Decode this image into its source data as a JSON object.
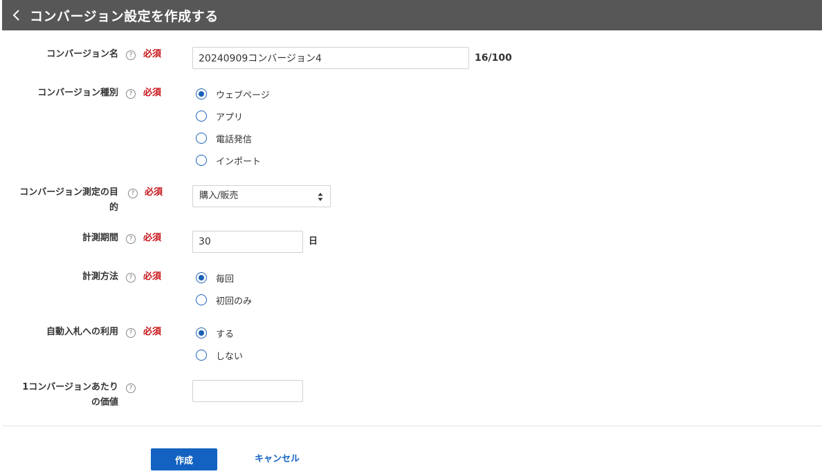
{
  "header": {
    "title": "コンバージョン設定を作成する"
  },
  "required_label": "必須",
  "help_glyph": "?",
  "fields": {
    "name": {
      "label": "コンバージョン名",
      "value": "20240909コンバージョン4",
      "counter": "16/100"
    },
    "type": {
      "label": "コンバージョン種別",
      "options": [
        "ウェブページ",
        "アプリ",
        "電話発信",
        "インポート"
      ],
      "selected": 0
    },
    "purpose": {
      "label_line1": "コンバージョン測定の目",
      "label_line2": "的",
      "value": "購入/販売"
    },
    "period": {
      "label": "計測期間",
      "value": "30",
      "unit": "日"
    },
    "method": {
      "label": "計測方法",
      "options": [
        "毎回",
        "初回のみ"
      ],
      "selected": 0
    },
    "auto_bid": {
      "label": "自動入札への利用",
      "options": [
        "する",
        "しない"
      ],
      "selected": 0
    },
    "value_per_conv": {
      "label_line1": "1コンバージョンあたり",
      "label_line2": "の価値",
      "value": ""
    }
  },
  "actions": {
    "create": "作成",
    "cancel": "キャンセル"
  },
  "colors": {
    "header_bg": "#575757",
    "accent": "#1362c1",
    "required": "#c7141a"
  }
}
